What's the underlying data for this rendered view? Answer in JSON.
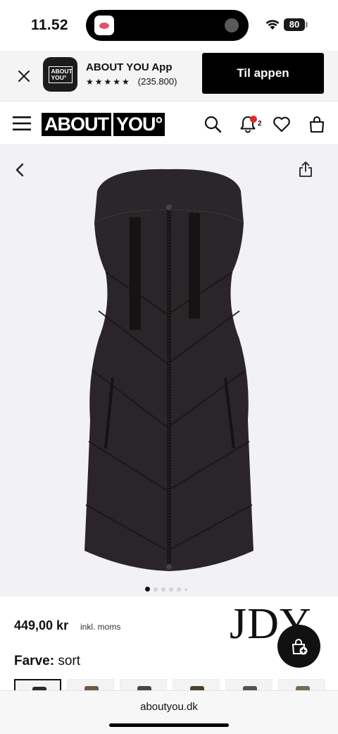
{
  "status_bar": {
    "time": "11.52",
    "battery": "80"
  },
  "app_banner": {
    "app_icon_text": "ABOUT YOU°",
    "app_name": "ABOUT YOU App",
    "stars": "★★★★★",
    "rating_count": "(235.800)",
    "cta_label": "Til appen"
  },
  "header": {
    "logo_left": "ABOUT",
    "logo_right": "YOU°",
    "notification_count": "2"
  },
  "gallery": {
    "image_count": 6,
    "active_index": 0
  },
  "product": {
    "price": "449,00 kr",
    "vat_note": "inkl. moms",
    "brand": "JDY",
    "color_label": "Farve:",
    "color_value": "sort"
  },
  "browser": {
    "url": "aboutyou.dk"
  },
  "colors": {
    "accent": "#000000",
    "notification_dot": "#e2262d",
    "gallery_bg": "#f2f2f4"
  }
}
